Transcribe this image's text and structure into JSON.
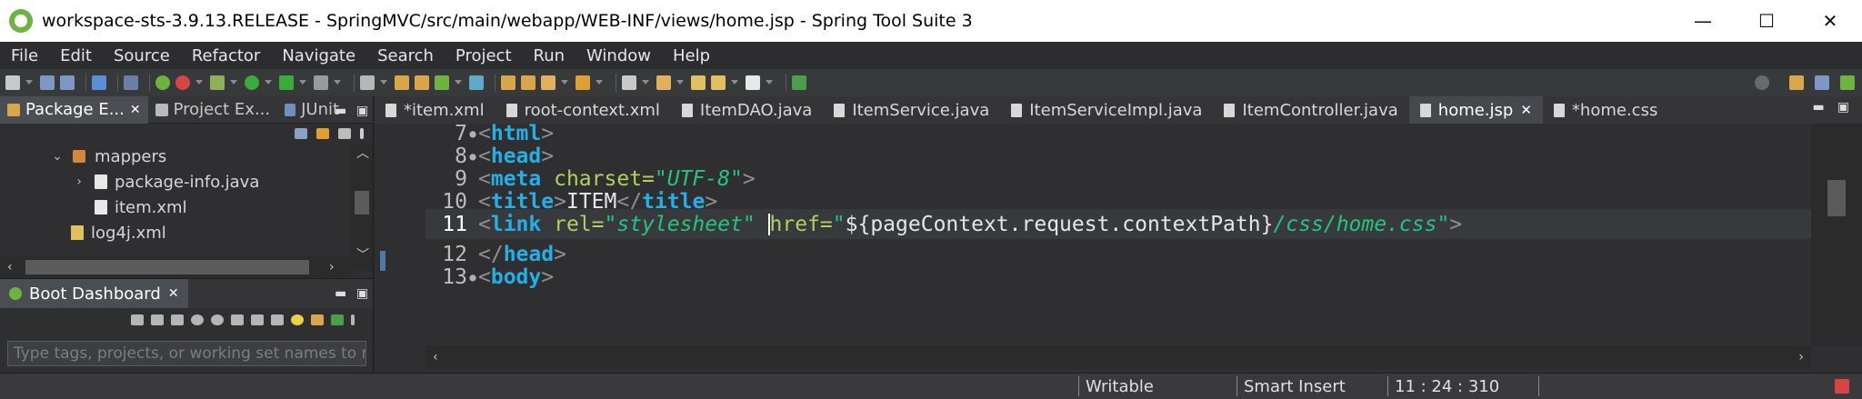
{
  "window": {
    "title": "workspace-sts-3.9.13.RELEASE - SpringMVC/src/main/webapp/WEB-INF/views/home.jsp - Spring Tool Suite 3",
    "minimize": "—",
    "maximize": "☐",
    "close": "✕"
  },
  "menu": [
    "File",
    "Edit",
    "Source",
    "Refactor",
    "Navigate",
    "Search",
    "Project",
    "Run",
    "Window",
    "Help"
  ],
  "explorer": {
    "tabs": [
      {
        "label": "Package E...",
        "close": "✕"
      },
      {
        "label": "Project Ex..."
      },
      {
        "label": "JUnit"
      }
    ],
    "tree": [
      {
        "label": "mappers",
        "chevron": "⌄"
      },
      {
        "label": "package-info.java",
        "chevron": "›"
      },
      {
        "label": "item.xml"
      },
      {
        "label": "log4j.xml"
      }
    ]
  },
  "boot": {
    "tab_label": "Boot Dashboard",
    "close": "✕",
    "filter_placeholder": "Type tags, projects, or working set names to ma"
  },
  "editor": {
    "tabs": [
      {
        "label": "*item.xml"
      },
      {
        "label": "root-context.xml"
      },
      {
        "label": "ItemDAO.java"
      },
      {
        "label": "ItemService.java"
      },
      {
        "label": "ItemServiceImpl.java"
      },
      {
        "label": "ItemController.java"
      },
      {
        "label": "home.jsp",
        "close": "✕"
      },
      {
        "label": "*home.css"
      }
    ],
    "lines": [
      {
        "num": "7",
        "fold": "●"
      },
      {
        "num": "8",
        "fold": "●"
      },
      {
        "num": "9"
      },
      {
        "num": "10"
      },
      {
        "num": "11"
      },
      {
        "num": "12"
      },
      {
        "num": "13",
        "fold": "●"
      }
    ],
    "code": {
      "l7_tag": "html",
      "l8_tag": "head",
      "l9_tag": "meta",
      "l9_attr": "charset=",
      "l9_val": "\"UTF-8\"",
      "l10_tag": "title",
      "l10_text": "ITEM",
      "l11_tag": "link",
      "l11_attr1": "rel=",
      "l11_val1": "\"stylesheet\"",
      "l11_attr2": "href=",
      "l11_val2a": "\"",
      "l11_el": "${pageContext.request.contextPath}",
      "l11_val2b": "/css/home.css\"",
      "l12_tag": "head",
      "l13_tag": "body"
    }
  },
  "status": {
    "mode": "Writable",
    "insert": "Smart Insert",
    "position": "11 : 24 : 310"
  }
}
